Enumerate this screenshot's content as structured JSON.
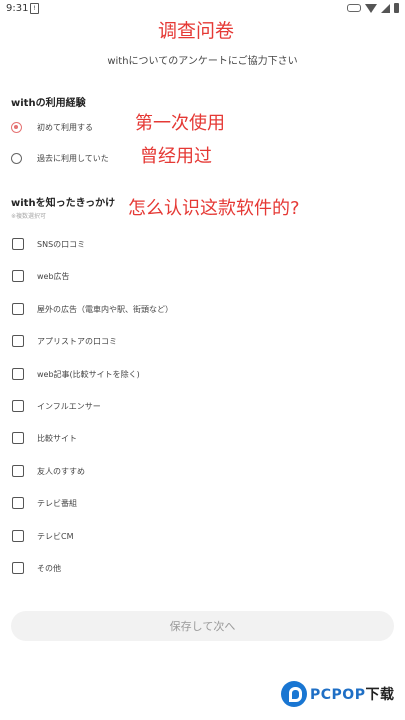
{
  "status_bar": {
    "time": "9:31",
    "sim": "!"
  },
  "annotations": {
    "title": "调查问卷",
    "first_use": "第一次使用",
    "used_before": "曾经用过",
    "how_know": "怎么认识这款软件的?"
  },
  "header": {
    "subtitle": "withについてのアンケートにご協力下さい"
  },
  "section_usage": {
    "title": "withの利用経験",
    "options": [
      "初めて利用する",
      "過去に利用していた"
    ],
    "selected_index": 0
  },
  "section_source": {
    "title": "withを知ったきっかけ",
    "note": "※複数選択可",
    "options": [
      "SNSの口コミ",
      "web広告",
      "屋外の広告（電車内や駅、街頭など）",
      "アプリストアの口コミ",
      "web記事(比較サイトを除く)",
      "インフルエンサー",
      "比較サイト",
      "友人のすすめ",
      "テレビ番組",
      "テレビCM",
      "その他"
    ]
  },
  "footer": {
    "save_label": "保存して次へ"
  },
  "watermark": {
    "brand": "PCPOP",
    "suffix": "下载"
  },
  "colors": {
    "accent": "#e57373",
    "annotation": "#e53935",
    "watermark": "#1f6fc5"
  }
}
